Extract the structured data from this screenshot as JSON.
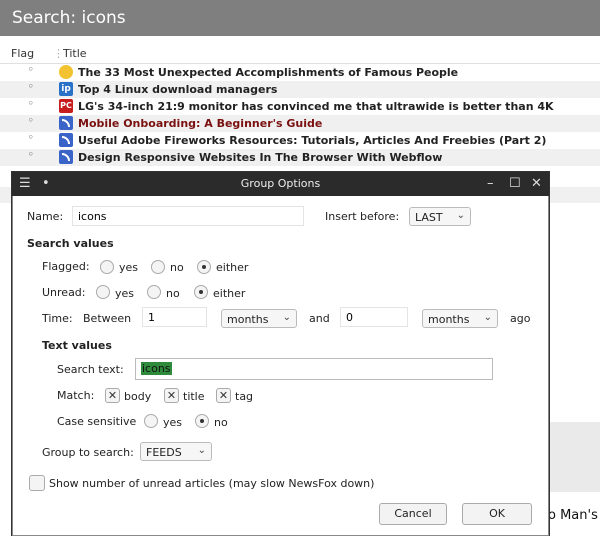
{
  "window_title": "Search: icons",
  "columns": {
    "flag": "Flag",
    "title": "Title"
  },
  "articles": [
    {
      "title": "The 33 Most Unexpected Accomplishments of Famous People",
      "icon": "gold-coin-icon",
      "read": false
    },
    {
      "title": "Top 4 Linux download managers",
      "icon": "ip-logo-icon",
      "read": false
    },
    {
      "title": "LG's 34-inch 21:9 monitor has convinced me that ultrawide is better than 4K",
      "icon": "pc-logo-icon",
      "read": false
    },
    {
      "title": "Mobile Onboarding: A Beginner's Guide",
      "icon": "feed-icon",
      "read": true
    },
    {
      "title": "Useful Adobe Fireworks Resources: Tutorials, Articles And Freebies (Part 2)",
      "icon": "feed-icon",
      "read": false
    },
    {
      "title": "Design Responsive Websites In The Browser With Webflow",
      "icon": "feed-icon",
      "read": false
    }
  ],
  "background_peek_text": "o Man's",
  "dialog": {
    "title": "Group Options",
    "name_label": "Name:",
    "name_value": "icons",
    "insert_before_label": "Insert before:",
    "insert_before_value": "LAST",
    "search_values_heading": "Search values",
    "flagged_label": "Flagged:",
    "unread_label": "Unread:",
    "opt_yes": "yes",
    "opt_no": "no",
    "opt_either": "either",
    "flagged_selected": "either",
    "unread_selected": "either",
    "time_label": "Time:",
    "between_label": "Between",
    "time_from": "1",
    "time_from_unit": "months",
    "and_label": "and",
    "time_to": "0",
    "time_to_unit": "months",
    "ago_label": "ago",
    "text_values_heading": "Text values",
    "search_text_label": "Search text:",
    "search_text_value": "icons",
    "match_label": "Match:",
    "match_body": "body",
    "match_title": "title",
    "match_tag": "tag",
    "case_sensitive_label": "Case sensitive",
    "case_sensitive_selected": "no",
    "group_to_search_label": "Group to search:",
    "group_to_search_value": "FEEDS",
    "show_unread_label": "Show number of unread articles (may slow NewsFox down)",
    "cancel_label": "Cancel",
    "ok_label": "OK"
  }
}
